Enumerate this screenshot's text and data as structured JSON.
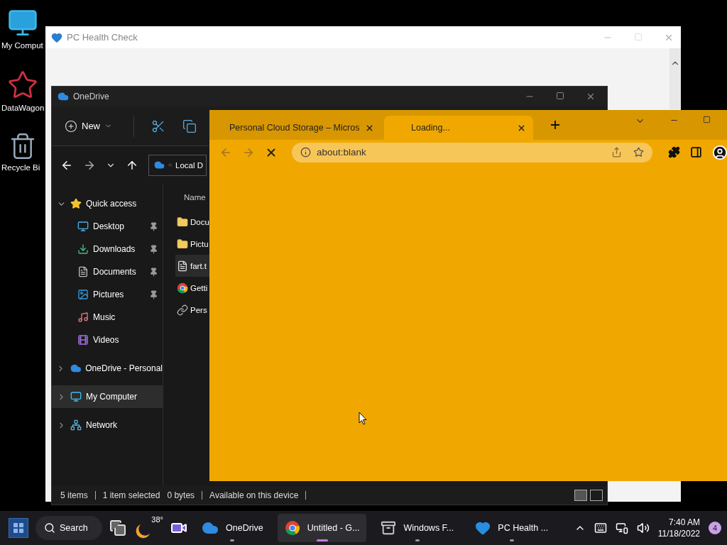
{
  "desktop_icons": [
    {
      "label": "My Comput",
      "kind": "computer"
    },
    {
      "label": "DataWagon",
      "kind": "star"
    },
    {
      "label": "Recycle Bi",
      "kind": "bin"
    }
  ],
  "health_window": {
    "title": "PC Health Check"
  },
  "explorer": {
    "title": "OneDrive",
    "new_label": "New",
    "address": "Local D",
    "column": "Name",
    "sidebar": [
      {
        "label": "Quick access",
        "kind": "star",
        "expanded": true,
        "selected": false,
        "children": [
          {
            "label": "Desktop",
            "kind": "desktop",
            "pinned": true,
            "selected": false
          },
          {
            "label": "Downloads",
            "kind": "downloads",
            "pinned": true,
            "selected": false
          },
          {
            "label": "Documents",
            "kind": "documents",
            "pinned": true,
            "selected": false
          },
          {
            "label": "Pictures",
            "kind": "pictures",
            "pinned": true,
            "selected": false
          },
          {
            "label": "Music",
            "kind": "music",
            "pinned": false,
            "selected": false
          },
          {
            "label": "Videos",
            "kind": "videos",
            "pinned": false,
            "selected": false
          }
        ]
      },
      {
        "label": "OneDrive - Personal",
        "kind": "cloud",
        "expanded": false,
        "selected": false
      },
      {
        "label": "My Computer",
        "kind": "computer",
        "expanded": false,
        "selected": true
      },
      {
        "label": "Network",
        "kind": "network",
        "expanded": false,
        "selected": false
      }
    ],
    "files": [
      {
        "name": "Docu",
        "kind": "folder",
        "selected": false
      },
      {
        "name": "Pictu",
        "kind": "folder",
        "selected": false
      },
      {
        "name": "fart.t",
        "kind": "text",
        "selected": true
      },
      {
        "name": "Getti",
        "kind": "chrome",
        "selected": false
      },
      {
        "name": "Pers",
        "kind": "shortcut",
        "selected": false
      }
    ],
    "status": {
      "count": "5 items",
      "selection": "1 item selected",
      "size": "0 bytes",
      "availability": "Available on this device"
    }
  },
  "browser": {
    "tabs": [
      {
        "label": "Personal Cloud Storage – Micros",
        "kind": "microsoft",
        "selected": false
      },
      {
        "label": "Loading...",
        "kind": "loading",
        "selected": true
      }
    ],
    "address": "about:blank"
  },
  "taskbar": {
    "search": "Search",
    "weather": "38°",
    "apps": [
      {
        "label": "OneDrive",
        "kind": "cloud",
        "active": false
      },
      {
        "label": "Untitled - G...",
        "kind": "chrome",
        "active": true
      },
      {
        "label": "Windows F...",
        "kind": "archive",
        "active": false
      },
      {
        "label": "PC Health ...",
        "kind": "heart",
        "active": false
      }
    ],
    "time": "7:40 AM",
    "date": "11/18/2022",
    "notifications": "4"
  }
}
